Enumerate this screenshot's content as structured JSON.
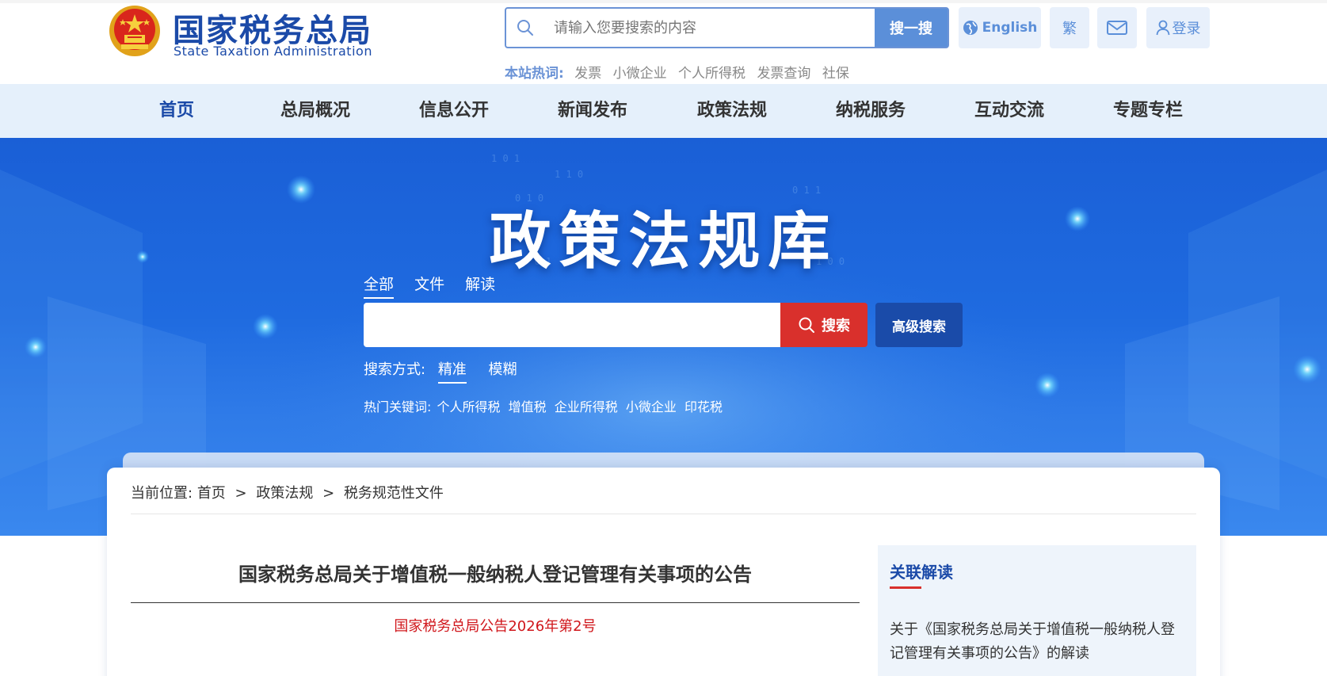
{
  "header": {
    "logo_cn": "国家税务总局",
    "logo_en": "State Taxation Administration",
    "search_placeholder": "请输入您要搜索的内容",
    "search_button": "搜一搜",
    "english_button": "English",
    "traditional_button": "繁",
    "login_button": "登录",
    "hot_label": "本站热词:",
    "hot_words": [
      "发票",
      "小微企业",
      "个人所得税",
      "发票查询",
      "社保"
    ]
  },
  "nav": {
    "items": [
      "首页",
      "总局概况",
      "信息公开",
      "新闻发布",
      "政策法规",
      "纳税服务",
      "互动交流",
      "专题专栏"
    ],
    "active_index": 0
  },
  "banner": {
    "title": "政策法规库",
    "tabs": [
      "全部",
      "文件",
      "解读"
    ],
    "active_tab": 0,
    "search_button": "搜索",
    "advanced_button": "高级搜索",
    "mode_label": "搜索方式:",
    "modes": [
      "精准",
      "模糊"
    ],
    "active_mode": 0,
    "hot_label": "热门关键词:",
    "hot_keywords": [
      "个人所得税",
      "增值税",
      "企业所得税",
      "小微企业",
      "印花税"
    ]
  },
  "breadcrumb": {
    "label": "当前位置:",
    "items": [
      "首页",
      "政策法规",
      "税务规范性文件"
    ],
    "separator": ">"
  },
  "document": {
    "title": "国家税务总局关于增值税一般纳税人登记管理有关事项的公告",
    "number": "国家税务总局公告2026年第2号"
  },
  "sidebar": {
    "title": "关联解读",
    "link": "关于《国家税务总局关于增值税一般纳税人登记管理有关事项的公告》的解读"
  },
  "colors": {
    "brand_blue": "#1b4aa8",
    "nav_bg": "#e5f0fb",
    "search_red": "#d9302c",
    "doc_number_red": "#d0161b"
  }
}
